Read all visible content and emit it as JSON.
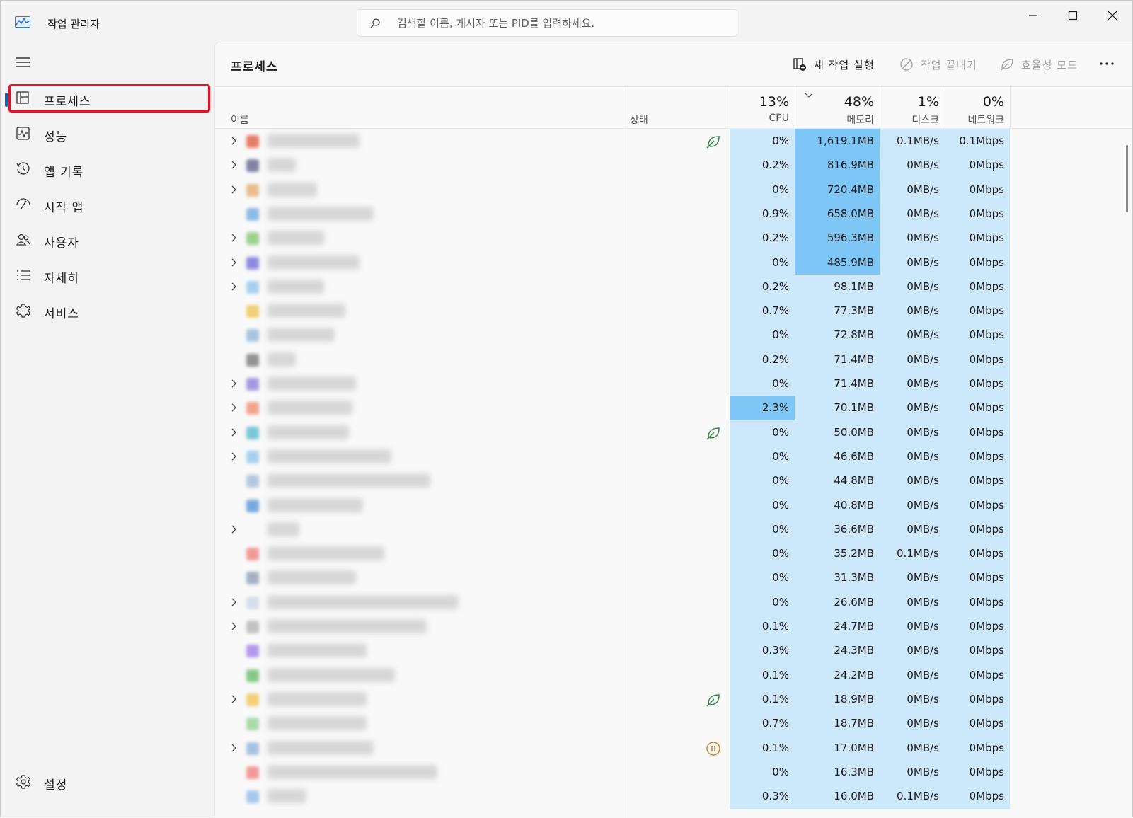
{
  "app": {
    "title": "작업 관리자"
  },
  "search": {
    "placeholder": "검색할 이름, 게시자 또는 PID를 입력하세요."
  },
  "sidebar": {
    "items": [
      {
        "label": "프로세스",
        "icon": "processes-icon",
        "active": true
      },
      {
        "label": "성능",
        "icon": "performance-icon"
      },
      {
        "label": "앱 기록",
        "icon": "app-history-icon"
      },
      {
        "label": "시작 앱",
        "icon": "startup-apps-icon"
      },
      {
        "label": "사용자",
        "icon": "users-icon"
      },
      {
        "label": "자세히",
        "icon": "details-icon"
      },
      {
        "label": "서비스",
        "icon": "services-icon"
      }
    ],
    "settings_label": "설정"
  },
  "main": {
    "title": "프로세스",
    "commands": {
      "new_task": "새 작업 실행",
      "end_task": "작업 끝내기",
      "efficiency": "효율성 모드"
    }
  },
  "table": {
    "columns": {
      "name": "이름",
      "status": "상태",
      "cpu": {
        "pct": "13%",
        "label": "CPU"
      },
      "memory": {
        "pct": "48%",
        "label": "메모리"
      },
      "disk": {
        "pct": "1%",
        "label": "디스크"
      },
      "network": {
        "pct": "0%",
        "label": "네트워크"
      }
    },
    "colors": {
      "light": "#cde8fb",
      "medium": "#9fd2f8",
      "strong": "#7ec6f5"
    },
    "rows": [
      {
        "exp": true,
        "status": "efficiency",
        "cpu": "0%",
        "mem": "1,619.1MB",
        "disk": "0.1MB/s",
        "net": "0.1Mbps",
        "cpuHeat": 0,
        "memHeat": 2,
        "icon": "#e0553b"
      },
      {
        "exp": true,
        "status": "",
        "cpu": "0.2%",
        "mem": "816.9MB",
        "disk": "0MB/s",
        "net": "0Mbps",
        "cpuHeat": 0,
        "memHeat": 2,
        "icon": "#5b5b8a"
      },
      {
        "exp": true,
        "status": "",
        "cpu": "0%",
        "mem": "720.4MB",
        "disk": "0MB/s",
        "net": "0Mbps",
        "cpuHeat": 0,
        "memHeat": 2,
        "icon": "#e5a96b"
      },
      {
        "exp": false,
        "status": "",
        "cpu": "0.9%",
        "mem": "658.0MB",
        "disk": "0MB/s",
        "net": "0Mbps",
        "cpuHeat": 0,
        "memHeat": 2,
        "icon": "#6aa6e0"
      },
      {
        "exp": true,
        "status": "",
        "cpu": "0.2%",
        "mem": "596.3MB",
        "disk": "0MB/s",
        "net": "0Mbps",
        "cpuHeat": 0,
        "memHeat": 2,
        "icon": "#7fc46a"
      },
      {
        "exp": true,
        "status": "",
        "cpu": "0%",
        "mem": "485.9MB",
        "disk": "0MB/s",
        "net": "0Mbps",
        "cpuHeat": 0,
        "memHeat": 2,
        "icon": "#6b67d6"
      },
      {
        "exp": true,
        "status": "",
        "cpu": "0.2%",
        "mem": "98.1MB",
        "disk": "0MB/s",
        "net": "0Mbps",
        "cpuHeat": 0,
        "memHeat": 0,
        "icon": "#8cc3ec"
      },
      {
        "exp": false,
        "status": "",
        "cpu": "0.7%",
        "mem": "77.3MB",
        "disk": "0MB/s",
        "net": "0Mbps",
        "cpuHeat": 0,
        "memHeat": 0,
        "icon": "#f0c14b"
      },
      {
        "exp": false,
        "status": "",
        "cpu": "0%",
        "mem": "72.8MB",
        "disk": "0MB/s",
        "net": "0Mbps",
        "cpuHeat": 0,
        "memHeat": 0,
        "icon": "#8db4d8"
      },
      {
        "exp": false,
        "status": "",
        "cpu": "0.2%",
        "mem": "71.4MB",
        "disk": "0MB/s",
        "net": "0Mbps",
        "cpuHeat": 0,
        "memHeat": 0,
        "icon": "#707070"
      },
      {
        "exp": true,
        "status": "",
        "cpu": "0%",
        "mem": "71.4MB",
        "disk": "0MB/s",
        "net": "0Mbps",
        "cpuHeat": 0,
        "memHeat": 0,
        "icon": "#8a7ad6"
      },
      {
        "exp": true,
        "status": "",
        "cpu": "2.3%",
        "mem": "70.1MB",
        "disk": "0MB/s",
        "net": "0Mbps",
        "cpuHeat": 2,
        "memHeat": 0,
        "icon": "#f08a6a"
      },
      {
        "exp": true,
        "status": "efficiency",
        "cpu": "0%",
        "mem": "50.0MB",
        "disk": "0MB/s",
        "net": "0Mbps",
        "cpuHeat": 0,
        "memHeat": 0,
        "icon": "#4fb7c9"
      },
      {
        "exp": true,
        "status": "",
        "cpu": "0%",
        "mem": "46.6MB",
        "disk": "0MB/s",
        "net": "0Mbps",
        "cpuHeat": 0,
        "memHeat": 0,
        "icon": "#8cc3ec"
      },
      {
        "exp": false,
        "status": "",
        "cpu": "0%",
        "mem": "44.8MB",
        "disk": "0MB/s",
        "net": "0Mbps",
        "cpuHeat": 0,
        "memHeat": 0,
        "icon": "#9cb8d6"
      },
      {
        "exp": false,
        "status": "",
        "cpu": "0%",
        "mem": "40.8MB",
        "disk": "0MB/s",
        "net": "0Mbps",
        "cpuHeat": 0,
        "memHeat": 0,
        "icon": "#4e8fd6"
      },
      {
        "exp": true,
        "status": "",
        "cpu": "0%",
        "mem": "36.6MB",
        "disk": "0MB/s",
        "net": "0Mbps",
        "cpuHeat": 0,
        "memHeat": 0,
        "icon": ""
      },
      {
        "exp": false,
        "status": "",
        "cpu": "0%",
        "mem": "35.2MB",
        "disk": "0.1MB/s",
        "net": "0Mbps",
        "cpuHeat": 0,
        "memHeat": 0,
        "icon": "#f07a7a"
      },
      {
        "exp": false,
        "status": "",
        "cpu": "0%",
        "mem": "31.3MB",
        "disk": "0MB/s",
        "net": "0Mbps",
        "cpuHeat": 0,
        "memHeat": 0,
        "icon": "#8a9ab0"
      },
      {
        "exp": true,
        "status": "",
        "cpu": "0%",
        "mem": "26.6MB",
        "disk": "0MB/s",
        "net": "0Mbps",
        "cpuHeat": 0,
        "memHeat": 0,
        "icon": "#c9d6e6"
      },
      {
        "exp": true,
        "status": "",
        "cpu": "0.1%",
        "mem": "24.7MB",
        "disk": "0MB/s",
        "net": "0Mbps",
        "cpuHeat": 0,
        "memHeat": 0,
        "icon": "#b0b0b0"
      },
      {
        "exp": false,
        "status": "",
        "cpu": "0.3%",
        "mem": "24.3MB",
        "disk": "0MB/s",
        "net": "0Mbps",
        "cpuHeat": 0,
        "memHeat": 0,
        "icon": "#9b7ae6"
      },
      {
        "exp": false,
        "status": "",
        "cpu": "0.1%",
        "mem": "24.2MB",
        "disk": "0MB/s",
        "net": "0Mbps",
        "cpuHeat": 0,
        "memHeat": 0,
        "icon": "#5fb85f"
      },
      {
        "exp": true,
        "status": "efficiency",
        "cpu": "0.1%",
        "mem": "18.9MB",
        "disk": "0MB/s",
        "net": "0Mbps",
        "cpuHeat": 0,
        "memHeat": 0,
        "icon": "#f0c14b"
      },
      {
        "exp": false,
        "status": "",
        "cpu": "0.7%",
        "mem": "18.7MB",
        "disk": "0MB/s",
        "net": "0Mbps",
        "cpuHeat": 0,
        "memHeat": 0,
        "icon": "#8fd08f"
      },
      {
        "exp": true,
        "status": "suspended",
        "cpu": "0.1%",
        "mem": "17.0MB",
        "disk": "0MB/s",
        "net": "0Mbps",
        "cpuHeat": 0,
        "memHeat": 0,
        "icon": "#8cb0d8"
      },
      {
        "exp": false,
        "status": "",
        "cpu": "0%",
        "mem": "16.3MB",
        "disk": "0MB/s",
        "net": "0Mbps",
        "cpuHeat": 0,
        "memHeat": 0,
        "icon": "#f07a7a"
      },
      {
        "exp": false,
        "status": "",
        "cpu": "0.3%",
        "mem": "16.0MB",
        "disk": "0.1MB/s",
        "net": "0Mbps",
        "cpuHeat": 0,
        "memHeat": 0,
        "icon": "#8cb8e8"
      }
    ]
  }
}
